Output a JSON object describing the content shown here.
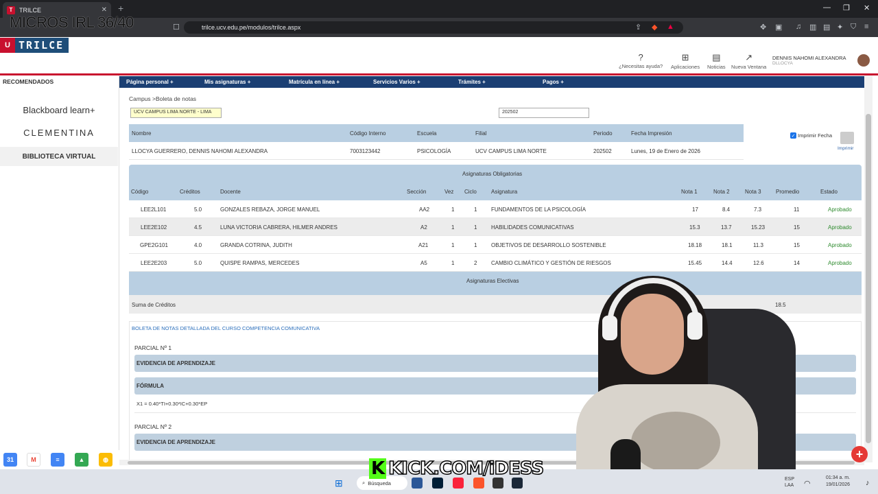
{
  "browser": {
    "tab_title": "TRILCE",
    "url": "trilce.ucv.edu.pe/modulos/trilce.aspx",
    "overlay_text": "MICROS IRL 36/40"
  },
  "site": {
    "brand": "TRILCE",
    "header_actions": [
      {
        "icon": "help-circle-icon",
        "label": "¿Necesitas ayuda?"
      },
      {
        "icon": "apps-grid-icon",
        "label": "Aplicaciones"
      },
      {
        "icon": "news-icon",
        "label": "Noticias"
      },
      {
        "icon": "external-link-icon",
        "label": "Nueva Ventana"
      }
    ],
    "user_name": "DENNIS NAHOMI ALEXANDRA",
    "user_sub": "DLLOCYA"
  },
  "sidebar": {
    "title": "RECOMENDADOS",
    "items": [
      "Blackboard learn+",
      "CLEMENTINA",
      "BIBLIOTECA VIRTUAL"
    ]
  },
  "nav": [
    "Página personal +",
    "Mis asignaturas +",
    "Matrícula en línea +",
    "Servicios Varios +",
    "Trámites +",
    "Pagos +"
  ],
  "breadcrumb": "Campus >Boleta de notas",
  "filters": {
    "campus": "UCV CAMPUS LIMA NORTE - LIMA",
    "period": "202502"
  },
  "info": {
    "headers": [
      "Nombre",
      "Código Interno",
      "Escuela",
      "Filial",
      "Periodo",
      "Fecha Impresión"
    ],
    "values": [
      "LLOCYA GUERRERO, DENNIS NAHOMI ALEXANDRA",
      "7003123442",
      "PSICOLOGÍA",
      "UCV CAMPUS LIMA NORTE",
      "202502",
      "Lunes, 19 de Enero de 2026"
    ],
    "print_date_label": "Imprimir Fecha",
    "print_label": "Imprimir"
  },
  "courses": {
    "title": "Asignaturas Obligatorias",
    "electives_title": "Asignaturas Electivas",
    "headers": [
      "Código",
      "Créditos",
      "Docente",
      "Sección",
      "Vez",
      "Ciclo",
      "Asignatura",
      "Nota 1",
      "Nota 2",
      "Nota 3",
      "Promedio",
      "Estado"
    ],
    "rows": [
      [
        "LEE2L101",
        "5.0",
        "GONZALES REBAZA, JORGE MANUEL",
        "AA2",
        "1",
        "1",
        "FUNDAMENTOS DE LA PSICOLOGÍA",
        "17",
        "8.4",
        "7.3",
        "11",
        "Aprobado"
      ],
      [
        "LEE2E102",
        "4.5",
        "LUNA VICTORIA CABRERA, HILMER ANDRES",
        "A2",
        "1",
        "1",
        "HABILIDADES COMUNICATIVAS",
        "15.3",
        "13.7",
        "15.23",
        "15",
        "Aprobado"
      ],
      [
        "GPE2G101",
        "4.0",
        "GRANDA COTRINA, JUDITH",
        "A21",
        "1",
        "1",
        "OBJETIVOS DE DESARROLLO SOSTENIBLE",
        "18.18",
        "18.1",
        "11.3",
        "15",
        "Aprobado"
      ],
      [
        "LEE2E203",
        "5.0",
        "QUISPE RAMPAS, MERCEDES",
        "A5",
        "1",
        "2",
        "CAMBIO CLIMÁTICO Y GESTIÓN DE RIESGOS",
        "15.45",
        "14.4",
        "12.6",
        "14",
        "Aprobado"
      ]
    ],
    "credits_label": "Suma de Créditos",
    "credits_total": "18.5"
  },
  "detail": {
    "title": "BOLETA DE NOTAS DETALLADA DEL CURSO COMPETENCIA COMUNICATIVA",
    "parcial1": "PARCIAL Nº 1",
    "evidencia": "EVIDENCIA DE APRENDIZAJE",
    "formula_title": "FÓRMULA",
    "formula": "X1 = 0.40*TI+0.30*IC+0.30*EP",
    "parcial2": "PARCIAL Nº 2"
  },
  "overlay": {
    "kick": "KICK.COM/iDESS"
  },
  "taskbar": {
    "search": "Búsqueda",
    "lang1": "ESP",
    "lang2": "LAA",
    "time": "01:34 a. m.",
    "date": "19/01/2026"
  },
  "colors": {
    "brand_red": "#c8102e",
    "navbar": "#1b3f73",
    "table_header": "#b9cfe2",
    "approved": "#2e8b2e"
  }
}
